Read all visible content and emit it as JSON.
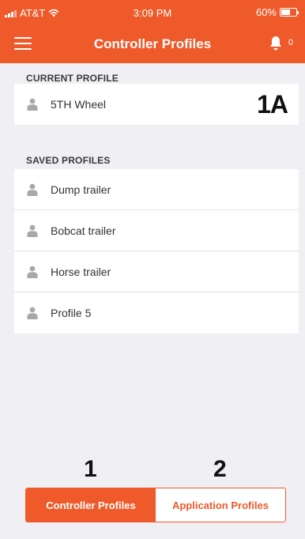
{
  "status": {
    "carrier": "AT&T",
    "time": "3:09 PM",
    "battery": "60%",
    "battery_level": 0.6
  },
  "nav": {
    "title": "Controller Profiles",
    "notification_count": "0",
    "icons": [
      "menu-icon",
      "bell-icon"
    ]
  },
  "current": {
    "section_label": "CURRENT PROFILE",
    "profile": "5TH Wheel",
    "badge": "1A"
  },
  "saved": {
    "section_label": "SAVED PROFILES",
    "items": [
      {
        "label": "Dump trailer"
      },
      {
        "label": "Bobcat trailer"
      },
      {
        "label": "Horse trailer"
      },
      {
        "label": "Profile 5"
      }
    ]
  },
  "tabs": {
    "num1": "1",
    "num2": "2",
    "controller_label": "Controller Profiles",
    "application_label": "Application Profiles"
  },
  "colors": {
    "accent": "#ee5a2a",
    "background": "#efeff4"
  }
}
